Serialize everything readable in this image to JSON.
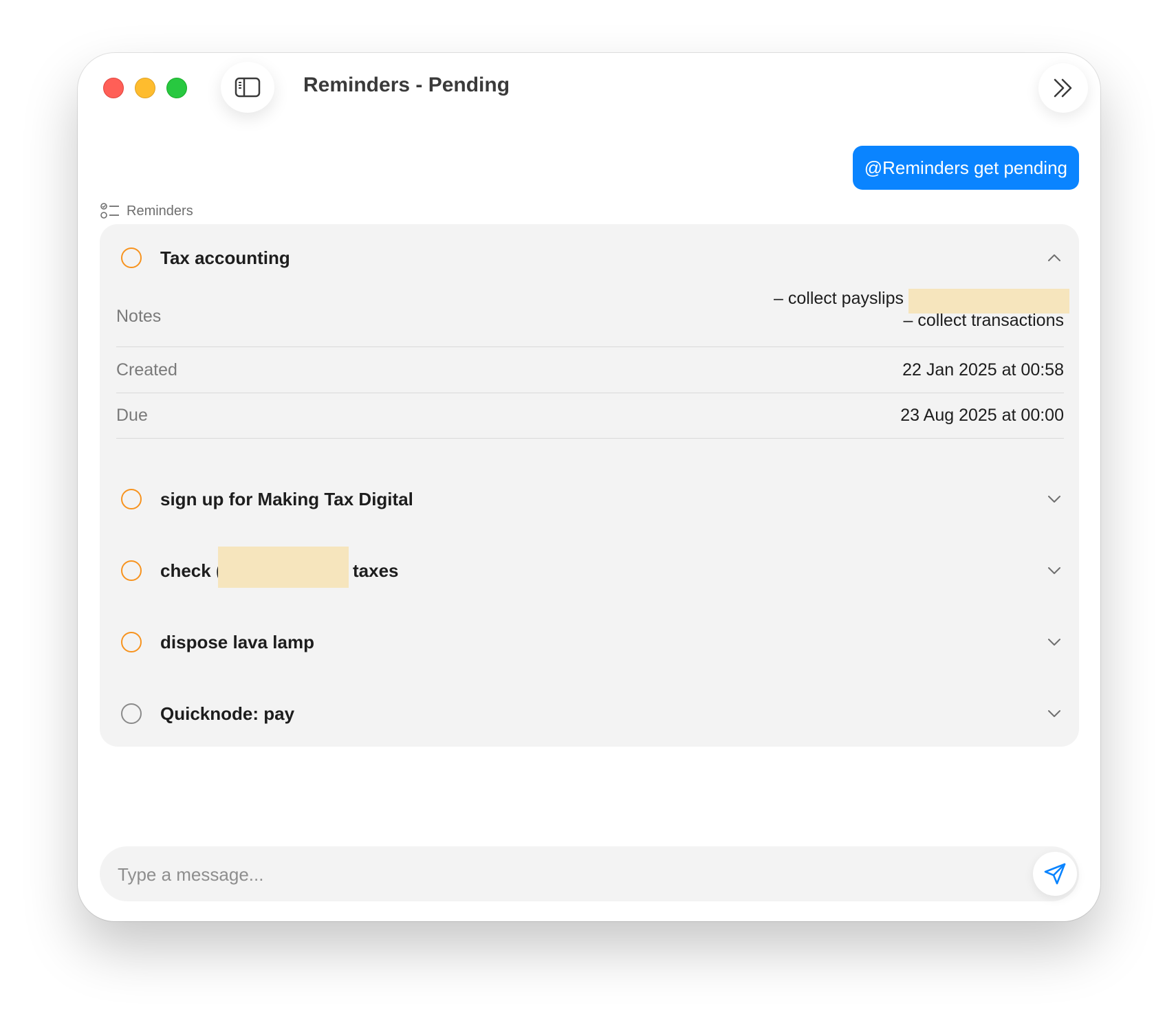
{
  "window": {
    "title": "Reminders - Pending"
  },
  "chat": {
    "user_message": "@Reminders get pending"
  },
  "reminders_section": {
    "label": "Reminders",
    "icon": "checklist-icon",
    "expanded_item": {
      "title": "Tax accounting",
      "notes_label": "Notes",
      "notes_line1": "– collect payslips",
      "notes_line2": "– collect transactions",
      "created_label": "Created",
      "created_value": "22 Jan 2025 at 00:58",
      "due_label": "Due",
      "due_value": "23 Aug 2025 at 00:00"
    },
    "items": [
      {
        "title": "sign up for Making Tax Digital"
      },
      {
        "title_prefix": "check (",
        "title_suffix": "taxes"
      },
      {
        "title": "dispose lava lamp"
      },
      {
        "title": "Quicknode: pay"
      }
    ]
  },
  "input": {
    "placeholder": "Type a message..."
  },
  "colors": {
    "accent": "#0a84ff",
    "reminder_circle": "#f7931e",
    "reminder_circle_neutral": "#8a8a8a",
    "redaction": "#f6e5bd"
  }
}
